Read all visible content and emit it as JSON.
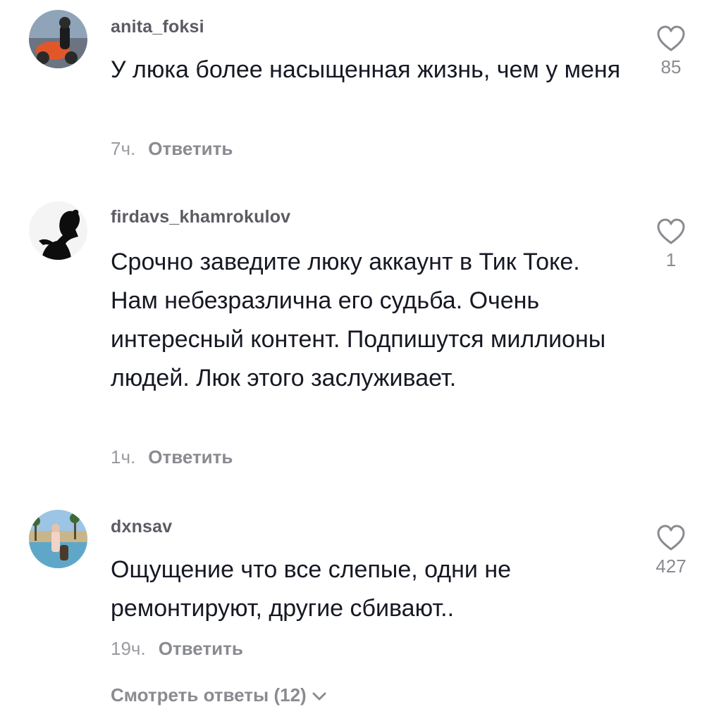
{
  "comments": [
    {
      "username": "anita_foksi",
      "text": "У люка более насыщенная жизнь, чем у меня",
      "time": "7ч.",
      "reply_label": "Ответить",
      "likes": "85",
      "avatar_icon": "avatar-motorcycle-photo"
    },
    {
      "username": "firdavs_khamrokulov",
      "text": "Срочно заведите люку аккаунт в Тик Токе. Нам небезразлична его судьба. Очень интересный контент. Подпишутся миллионы людей. Люк этого заслуживает.",
      "time": "1ч.",
      "reply_label": "Ответить",
      "likes": "1",
      "avatar_icon": "avatar-silhouette-photo"
    },
    {
      "username": "dxnsav",
      "text": "Ощущение что все слепые, одни не ремонтируют, другие сбивают..",
      "time": "19ч.",
      "reply_label": "Ответить",
      "likes": "427",
      "avatar_icon": "avatar-pool-photo"
    }
  ],
  "view_replies_label": "Смотреть ответы (12)",
  "colors": {
    "text_primary": "#161823",
    "text_secondary": "#8a8b91",
    "username": "#5b5c63",
    "background": "#ffffff"
  }
}
